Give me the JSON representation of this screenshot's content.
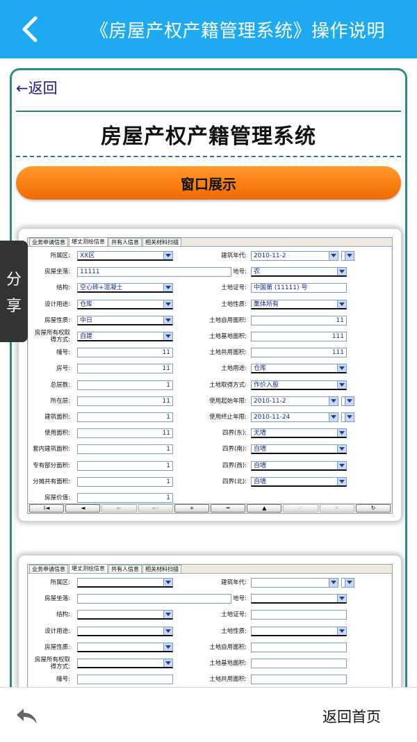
{
  "header": {
    "title": "《房屋产权产籍管理系统》操作说明"
  },
  "card": {
    "back_link": "←返回",
    "title": "房屋产权产籍管理系统",
    "section_title": "窗口展示"
  },
  "share": {
    "line1": "分",
    "line2": "享"
  },
  "footer": {
    "home_label": "返回首页"
  },
  "screenshot_window": {
    "tabs": [
      "业务申请信息",
      "堪丈测绘信息",
      "共有人信息",
      "相关材料扫描"
    ],
    "active_tab": 1,
    "left_labels": [
      "所属区:",
      "房屋坐落:",
      "结构:",
      "设计用途:",
      "房屋性质:",
      "房屋所有权取得方式:",
      "幢号:",
      "房号:",
      "总层数:",
      "所在层:",
      "建筑面积:",
      "使用面积:",
      "套内建筑面积:",
      "专有部分面积:",
      "分摊共有面积:",
      "房屋价值:"
    ],
    "right_labels": [
      "建筑年代:",
      "地号:",
      "土地证号:",
      "土地性质:",
      "土地自用面积:",
      "土地基地面积:",
      "土地共用面积:",
      "土地用途:",
      "土地取得方式:",
      "使用起始年限:",
      "使用终止年限:",
      "四界(东):",
      "四界(南):",
      "四界(西):",
      "四界(北):"
    ],
    "left_values": [
      "XX区",
      "11111",
      "空心砖+混凝土",
      "仓库",
      "中日",
      "自建",
      "11",
      "11",
      "1",
      "11",
      "1",
      "11",
      "1",
      "1",
      "1",
      "1"
    ],
    "right_values": [
      "2010-11-2",
      "农",
      "中国第 (11111) 号",
      "集体所有",
      "11",
      "111",
      "111",
      "仓库",
      "作价入股",
      "2010-11-2",
      "2010-11-24",
      "无墙",
      "自墙",
      "自墙",
      "自墙"
    ],
    "nav_buttons": [
      "I◄",
      "◄",
      "►",
      "►I",
      "+",
      "━",
      "▲",
      "✓",
      "✕",
      "↻"
    ]
  }
}
